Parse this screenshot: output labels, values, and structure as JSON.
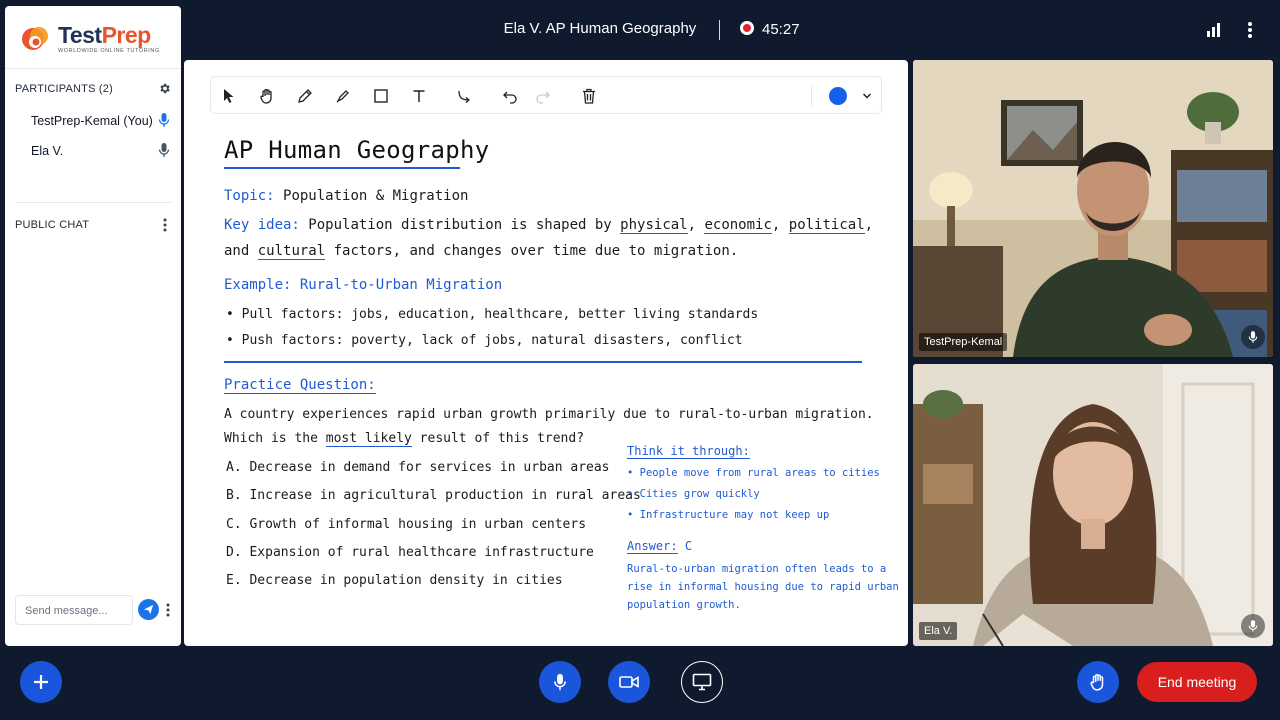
{
  "app": {
    "logo_main": "Test",
    "logo_accent": "Prep",
    "logo_tagline": "WORLDWIDE ONLINE TUTORING"
  },
  "header": {
    "meeting_title": "Ela V.  AP Human Geography",
    "recording_time": "45:27",
    "icons": [
      "signal-bars-icon",
      "more-vertical-icon"
    ]
  },
  "sidebar": {
    "participants_label": "PARTICIPANTS (2)",
    "participants": [
      {
        "name": "TestPrep-Kemal (You)",
        "mic": "active"
      },
      {
        "name": "Ela V.",
        "mic": "idle"
      }
    ],
    "public_chat_label": "PUBLIC CHAT",
    "chat_placeholder": "Send message..."
  },
  "whiteboard": {
    "tools": [
      "pointer",
      "hand",
      "pen",
      "highlighter",
      "rectangle",
      "text",
      "connector",
      "undo",
      "redo",
      "delete"
    ],
    "active_color": "#1560e8",
    "title": "AP Human Geography",
    "topic_label": "Topic:",
    "topic_value": "Population & Migration",
    "key_idea_label": "Key idea:",
    "key_idea_1a": "Population distribution is shaped by",
    "kw_physical": "physical",
    "kw_economic": "economic",
    "kw_political": "political",
    "key_idea_2a": "and",
    "kw_cultural": "cultural",
    "key_idea_2b": "factors, and changes over time due to migration.",
    "example_label": "Example: Rural-to-Urban Migration",
    "pull_factors": "• Pull factors: jobs, education, healthcare, better living standards",
    "push_factors": "• Push factors: poverty, lack of jobs, natural disasters, conflict",
    "practice_label": "Practice Question:",
    "question_1": "A country experiences rapid urban growth primarily due to rural-to-urban migration.",
    "question_2a": "Which is the",
    "question_2b": "most likely",
    "question_2c": "result of this trend?",
    "options": [
      "A. Decrease in demand for services in urban areas",
      "B. Increase in agricultural production in rural areas",
      "C. Growth of informal housing in urban centers",
      "D. Expansion of rural healthcare infrastructure",
      "E. Decrease in population density in cities"
    ],
    "think_label": "Think it through:",
    "think_points": [
      "• People move from rural areas to cities",
      "• Cities grow quickly",
      "• Infrastructure may not keep up"
    ],
    "answer_label": "Answer:",
    "answer_value": "C",
    "explanation": [
      "Rural-to-urban migration often leads to a",
      "rise in informal housing due to rapid urban",
      "population growth."
    ]
  },
  "videos": [
    {
      "name": "TestPrep-Kemal"
    },
    {
      "name": "Ela V."
    }
  ],
  "controls": {
    "end_meeting_label": "End meeting",
    "accent": "#1a56db",
    "end_color": "#d91e1e"
  }
}
